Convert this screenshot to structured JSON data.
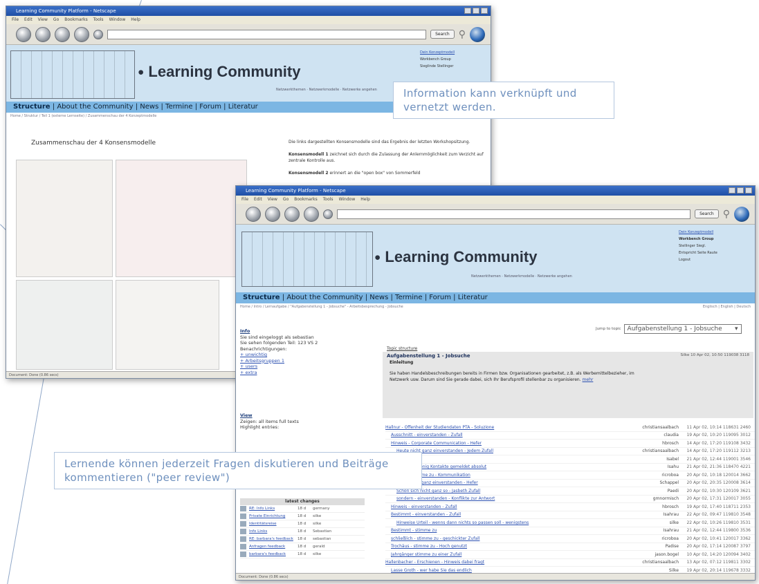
{
  "window_back": {
    "title": "Learning Community Platform - Netscape",
    "menu": [
      "File",
      "Edit",
      "View",
      "Go",
      "Bookmarks",
      "Tools",
      "Window",
      "Help"
    ],
    "search_label": "Search",
    "brand": "Learning Community",
    "brand_sub": "Netzwerkthemen · Netzwerkmodelle · Netzwerke angehen",
    "nav": [
      "Structure",
      "About the Community",
      "News",
      "Termine",
      "Forum",
      "Literatur"
    ],
    "breadcrumb": "Home / Struktur / Teil 1 (externe Lernseite) / Zusammenschau der 4 Konzeptmodelle",
    "page_heading": "Zusammenschau der 4 Konsensmodelle",
    "intro_1": "Die links dargestellten Konsensmodelle sind das Ergebnis der letzten Workshopsitzung.",
    "intro_2_bold": "Konsensmodell 1",
    "intro_2": "zeichnet sich durch die Zulassung der Anlernmöglichkeit zum Verzicht auf zentrale Kontrolle aus.",
    "intro_3_bold": "Konsensmodell 2",
    "intro_3": "erinnert an die \"open box\" von Sommerfeld",
    "status": "Document: Done (0.86 secs)",
    "right_links": [
      "Dein Konzeptmodell",
      "Workbench Group",
      "Sieglinde Stellinger"
    ]
  },
  "window_front": {
    "title": "Learning Community Platform - Netscape",
    "menu": [
      "File",
      "Edit",
      "View",
      "Go",
      "Bookmarks",
      "Tools",
      "Window",
      "Help"
    ],
    "search_label": "Search",
    "brand": "Learning Community",
    "brand_sub": "Netzwerkthemen · Netzwerkmodelle · Netzwerke angehen",
    "nav": [
      "Structure",
      "About the Community",
      "News",
      "Termine",
      "Forum",
      "Literatur"
    ],
    "breadcrumb": "Home / Intro / Lernaufgabe / \"Aufgabenstellung 1 - Jobsuche\" - Arbeitsbesprechung - Jobsuche",
    "lang_links": "Englisch | English | Deutsch",
    "right_links": [
      "Dein Konzeptmodell",
      "Workbench Group",
      "Stellinger Siegl.",
      "Entspricht Seite Raute",
      "Logout"
    ],
    "select_value": "Aufgabenstellung 1 - Jobsuche",
    "select_label": "Jump to topic",
    "sort_label": "Topic structure",
    "topic_title": "Aufgabenstellung 1 - Jobsuche",
    "topic_sub": "Einleitung",
    "topic_body": "Sie haben Handelsbeschreibungen bereits in Firmen bzw. Organisationen gearbeitet, z.B. als Werbemittelbezieher, im Netzwerk usw. Darum sind Sie gerade dabei, sich Ihr Berufsprofil stellenbar zu organisieren.",
    "read_more": "mehr",
    "topic_author": "Silke",
    "topic_date": "10 Apr 02, 10:50  119038  3118",
    "info_title": "Info",
    "info_lines": [
      "Sie sind eingeloggt als sebastian",
      "Sie sehen folgenden Teil: 123 VS 2",
      "Benachrichtigungen:"
    ],
    "info_items": [
      "+ unwichtig",
      "+ Arbeitsgruppen 1",
      "+ users",
      "+ extra"
    ],
    "view_title": "View",
    "view_lines": [
      "Zeigen: all items full texts",
      "Highlight entries:"
    ],
    "latest_title": "latest changes",
    "latest": [
      {
        "name": "RE: Info Links",
        "when": "18 d",
        "user": "germany"
      },
      {
        "name": "Private Einrichtung",
        "when": "18 d",
        "user": "silke"
      },
      {
        "name": "Identitätsreise",
        "when": "18 d",
        "user": "silke"
      },
      {
        "name": "Info Links",
        "when": "18 d",
        "user": "Sebastian"
      },
      {
        "name": "RE: barbara's feedback",
        "when": "18 d",
        "user": "sebastian"
      },
      {
        "name": "Anfragen feedback",
        "when": "18 d",
        "user": "gerald"
      },
      {
        "name": "barbara's feedback",
        "when": "18 d",
        "user": "silke"
      }
    ],
    "threads": [
      {
        "t": "Hallnur - Offenheit der Studiendaten PTA - Soluzione",
        "a": "christiansaalbach",
        "d": "11 Apr 02, 10:14 118631 2460"
      },
      {
        "t": "Ausschnitt - einverstanden - Zufall",
        "a": "claudia",
        "d": "19 Apr 02, 10:20 119095 3012"
      },
      {
        "t": "Hinweis - Corporate Communication - Hefer",
        "a": "hbrosch",
        "d": "14 Apr 02, 17:20 119108 3432"
      },
      {
        "t": "Heute nicht ganz einverstanden - Jedem Zufall",
        "a": "christiansaalbach",
        "d": "14 Apr 02, 17:20 119112 3213"
      },
      {
        "t": "Einsatz",
        "a": "Isabel",
        "d": "21 Apr 02, 12:44 119001 3546"
      },
      {
        "t": "Absolut - Wenig Kontakte gemeldet absolut",
        "a": "Isahu",
        "d": "21 Apr 02, 21:36 118470 4221"
      },
      {
        "t": "Frage - stimme zu - Kommunikation",
        "a": "ricroboa",
        "d": "20 Apr 02, 10:18 120014 3662"
      },
      {
        "t": "leider nicht ganz einverstanden - Hefer",
        "a": "Schappel",
        "d": "20 Apr 02, 20:35 120008 3614"
      },
      {
        "t": "Schon sich nicht ganz so - Jasbeth Zufall",
        "a": "Paedi",
        "d": "20 Apr 02, 10:30 120109 3621"
      },
      {
        "t": "sondern - einverstanden - Konflikte zur Antwort",
        "a": "gmnormisch",
        "d": "20 Apr 02, 17:31 120017 3055"
      },
      {
        "t": "Hinweis - einverstanden - Zufall",
        "a": "hbrosch",
        "d": "19 Apr 02, 17:40 118711 2353"
      },
      {
        "t": "Bestimmt - einverstanden - Zufall",
        "a": "Isahrau",
        "d": "22 Apr 02, 09:47 119810 3548"
      },
      {
        "t": "Hinweise Urteil - wenns dann nichts so passen soll - wenigstens",
        "a": "silke",
        "d": "22 Apr 02, 10:26 119810 3531"
      },
      {
        "t": "Bestimmt - stimme zu",
        "a": "Isahrau",
        "d": "21 Apr 02, 12:44 119800 3536"
      },
      {
        "t": "schließlich - stimme zu - geschickter Zufall",
        "a": "ricroboa",
        "d": "20 Apr 02, 10:41 120017 3362"
      },
      {
        "t": "Trochäus - stimme zu - Hoch genutzt",
        "a": "Padise",
        "d": "20 Apr 02, 17:14 120087 3797"
      },
      {
        "t": "Jahrgänger stimme zu einer Zufall",
        "a": "jason.bogel",
        "d": "10 Apr 02, 14:20 120094 3402"
      },
      {
        "t": "Hallenbacher - Erschienen - Hinweis dabei fragt",
        "a": "christiansaalbach",
        "d": "13 Apr 02, 07:12 119811 3302"
      },
      {
        "t": "Lasse Groth - wer habe Sie das endlich",
        "a": "Silke",
        "d": "19 Apr 02, 20:14 119678 3332"
      }
    ],
    "status": "Document: Done (0.86 secs)"
  },
  "callouts": {
    "top": "Information kann verknüpft und vernetzt werden.",
    "bottom": "Lernende können jederzeit Fragen diskutieren und Beiträge kommentieren (\"peer review\")"
  },
  "colors": {
    "accent": "#7cb6e3",
    "header": "#cfe3f2",
    "callout_text": "#6d8fbd"
  }
}
